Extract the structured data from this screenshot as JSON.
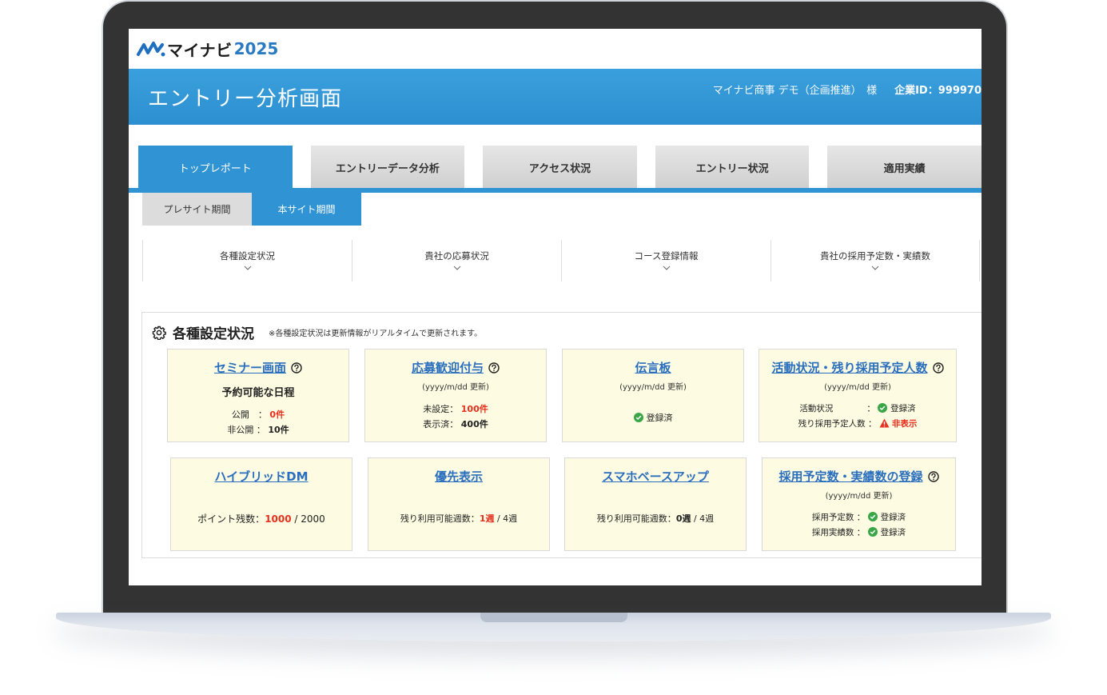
{
  "logo": {
    "brand": "マイナビ",
    "year": "2025"
  },
  "header": {
    "title": "エントリー分析画面",
    "company": "マイナビ商事 デモ（企画推進）　様",
    "company_id": "企業ID：999970"
  },
  "main_tabs": [
    {
      "label": "トップレポート",
      "active": true
    },
    {
      "label": "エントリーデータ分析",
      "active": false
    },
    {
      "label": "アクセス状況",
      "active": false
    },
    {
      "label": "エントリー状況",
      "active": false
    },
    {
      "label": "適用実績",
      "active": false
    }
  ],
  "sub_tabs": [
    {
      "label": "プレサイト期間",
      "active": false
    },
    {
      "label": "本サイト期間",
      "active": true
    }
  ],
  "section_nav": [
    {
      "label": "各種設定状況"
    },
    {
      "label": "貴社の応募状況"
    },
    {
      "label": "コース登録情報"
    },
    {
      "label": "貴社の採用予定数・実績数"
    }
  ],
  "panel": {
    "title": "各種設定状況",
    "note": "※各種設定状況は更新情報がリアルタイムで更新されます。"
  },
  "cards": {
    "seminar": {
      "title": "セミナー画面",
      "subtitle": "予約可能な日程",
      "public_label": "公開　：",
      "public_value": "0件",
      "private_label": "非公開 ：",
      "private_value": "10件"
    },
    "welcome": {
      "title": "応募歓迎付与",
      "updated": "(yyyy/m/dd 更新)",
      "unset_label": "未設定：",
      "unset_value": "100件",
      "shown_label": "表示済：",
      "shown_value": "400件"
    },
    "board": {
      "title": "伝言板",
      "updated": "(yyyy/m/dd 更新)",
      "status": "登録済"
    },
    "activity": {
      "title": "活動状況・残り採用予定人数",
      "updated": "(yyyy/m/dd 更新)",
      "activity_label": "活動状況　　　　：",
      "activity_status": "登録済",
      "remaining_label": "残り採用予定人数 ：",
      "remaining_status": "非表示"
    },
    "hybrid": {
      "title": "ハイブリッドDM",
      "label": "ポイント残数：",
      "value": "1000",
      "total": " / 2000"
    },
    "priority": {
      "title": "優先表示",
      "label": "残り利用可能週数：",
      "value": "1週",
      "total": " / 4週"
    },
    "smartphone": {
      "title": "スマホベースアップ",
      "label": "残り利用可能週数：",
      "value": "0週",
      "total": " / 4週"
    },
    "hiring": {
      "title": "採用予定数・実績数の登録",
      "updated": "(yyyy/m/dd 更新)",
      "planned_label": "採用予定数 ：",
      "planned_status": "登録済",
      "actual_label": "採用実績数 ：",
      "actual_status": "登録済"
    }
  },
  "colors": {
    "header_blue": "#2f93d4",
    "link_blue": "#2a6fbf",
    "alert_red": "#e8301e",
    "ok_green": "#3aa648",
    "card_bg": "#fdfbe1"
  }
}
